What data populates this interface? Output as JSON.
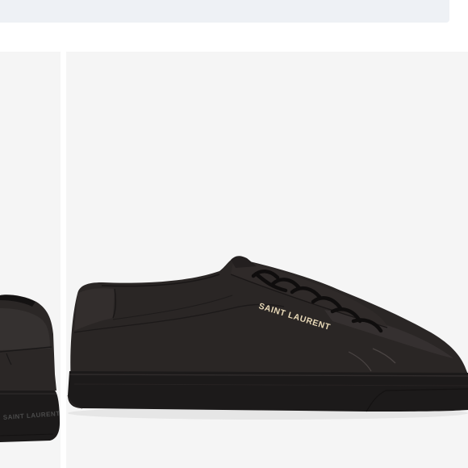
{
  "search": {
    "placeholder": ""
  },
  "product": {
    "brand_print": "SAINT LAURENT",
    "sole_print": "SAINT LAURENT"
  },
  "colors": {
    "top_bar": "#eef1f5",
    "image_background": "#f5f5f5",
    "shoe_leather": "#2a2625",
    "sole": "#1c1a1a",
    "brand_print": "#e8d9b8"
  },
  "icons": {
    "lace": "shoelace-icon"
  }
}
